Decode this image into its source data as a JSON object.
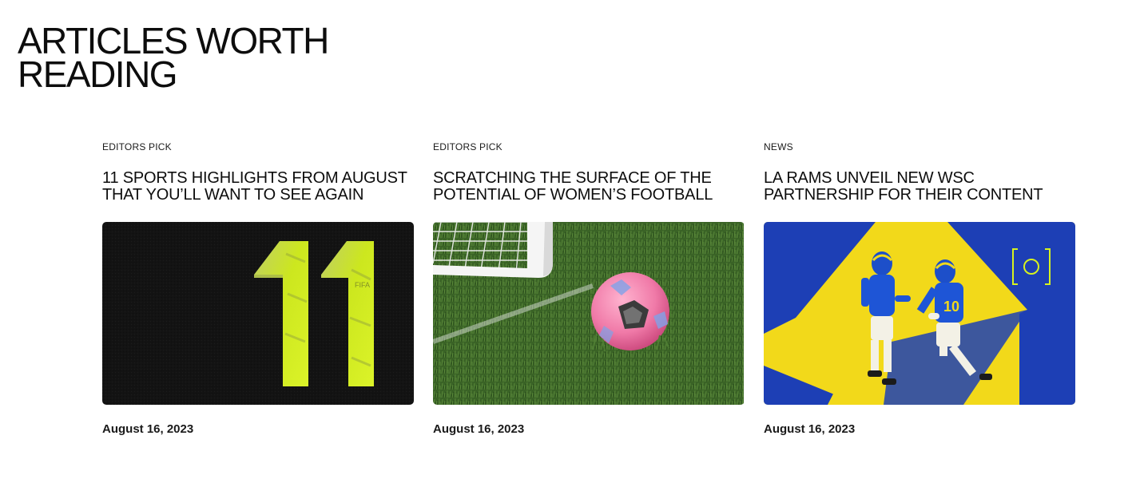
{
  "section": {
    "title_line1": "ARTICLES WORTH",
    "title_line2": "READING"
  },
  "articles": [
    {
      "category": "EDITORS PICK",
      "title_line1": "11 SPORTS HIGHLIGHTS FROM AUGUST",
      "title_line2": "THAT YOU’LL WANT TO SEE AGAIN",
      "image_text": "11",
      "image_subject": "yellow-number-eleven-graphic",
      "date": "August 16, 2023"
    },
    {
      "category": "EDITORS PICK",
      "title_line1": "SCRATCHING THE SURFACE OF THE",
      "title_line2": "POTENTIAL OF WOMEN’S FOOTBALL",
      "image_subject": "pink-football-on-grass-photo",
      "date": "August 16, 2023"
    },
    {
      "category": "NEWS",
      "title_line1": "LA RAMS UNVEIL NEW WSC",
      "title_line2": "PARTNERSHIP FOR THEIR CONTENT",
      "image_subject": "rams-players-celebrating-photo",
      "date": "August 16, 2023"
    }
  ],
  "colors": {
    "text": "#0d0d0d",
    "neon_yellow": "#d6f21f",
    "rams_blue": "#1d3fb5",
    "rams_yellow": "#f2d91a",
    "grass": "#3e6b2a",
    "ball_pink": "#f07aa8"
  }
}
